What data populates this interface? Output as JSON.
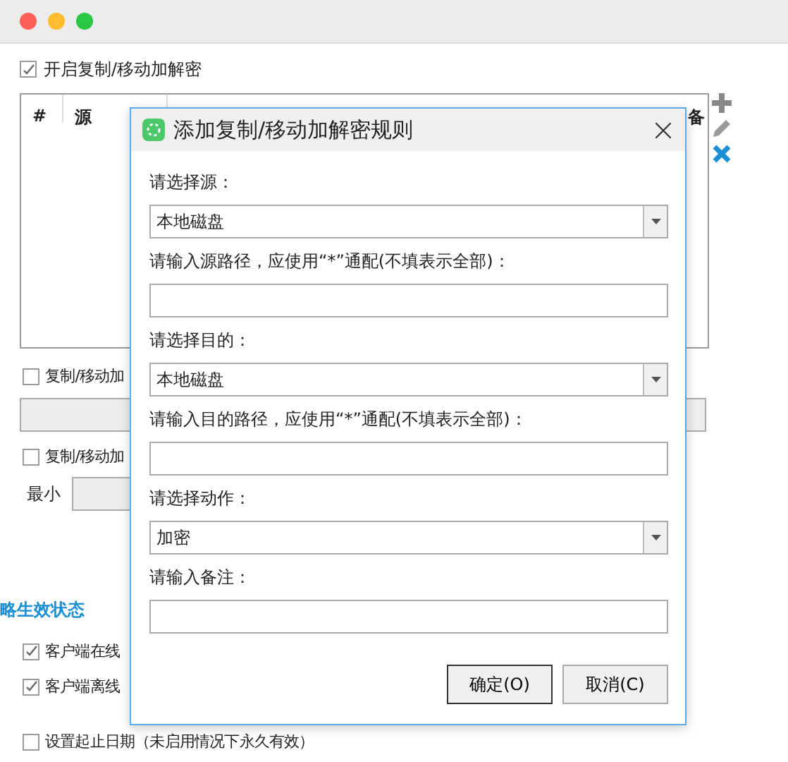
{
  "enable_checkbox": {
    "label": "开启复制/移动加解密",
    "checked": true
  },
  "rules_table": {
    "columns": [
      "#",
      "源",
      "备"
    ]
  },
  "option_rows": [
    {
      "kind": "checkbox",
      "label": "复制/移动加",
      "checked": false
    },
    {
      "kind": "field"
    },
    {
      "kind": "checkbox",
      "label": "复制/移动加",
      "checked": false
    },
    {
      "kind": "labeled_field",
      "label": "最小"
    }
  ],
  "section_title": "略生效状态",
  "status_options": [
    {
      "label": "客户端在线",
      "checked": true
    },
    {
      "label": "客户端离线",
      "checked": true
    },
    {
      "label": "设置起止日期（未启用情况下永久有效）",
      "checked": false
    }
  ],
  "dialog": {
    "title": "添加复制/移动加解密规则",
    "fields": [
      {
        "kind": "select",
        "label": "请选择源：",
        "value": "本地磁盘"
      },
      {
        "kind": "text",
        "label": "请输入源路径，应使用“*”通配(不填表示全部)："
      },
      {
        "kind": "select",
        "label": "请选择目的：",
        "value": "本地磁盘"
      },
      {
        "kind": "text",
        "label": "请输入目的路径，应使用“*”通配(不填表示全部)："
      },
      {
        "kind": "select",
        "label": "请选择动作：",
        "value": "加密"
      },
      {
        "kind": "text",
        "label": "请输入备注："
      }
    ],
    "buttons": [
      {
        "label": "确定(O)",
        "default": true
      },
      {
        "label": "取消(C)",
        "default": false
      }
    ]
  }
}
